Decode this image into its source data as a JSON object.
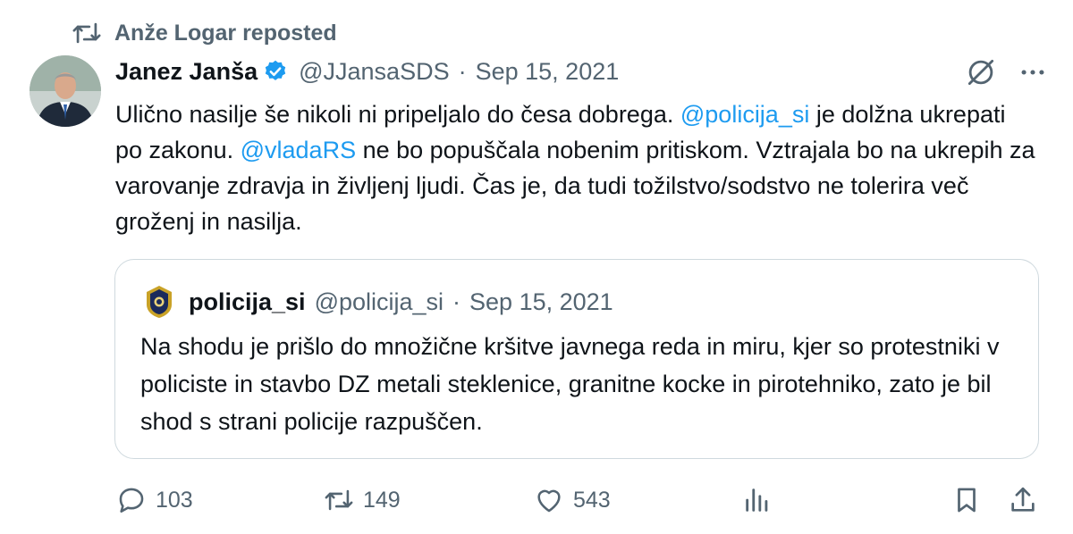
{
  "repost": {
    "label": "Anže Logar reposted"
  },
  "author": {
    "name": "Janez Janša",
    "handle": "@JJansaSDS",
    "separator": "·",
    "date": "Sep 15, 2021"
  },
  "tweet": {
    "part1": "Ulično nasilje še nikoli ni pripeljalo do česa dobrega. ",
    "mention1": "@policija_si",
    "part2": " je dolžna ukrepati po zakonu. ",
    "mention2": "@vladaRS",
    "part3": " ne bo popuščala nobenim pritiskom. Vztrajala bo na ukrepih za varovanje zdravja in življenj ljudi. Čas je, da tudi tožilstvo/sodstvo ne tolerira več groženj in nasilja."
  },
  "quoted": {
    "name": "policija_si",
    "handle": "@policija_si",
    "separator": "·",
    "date": "Sep 15, 2021",
    "text": "Na shodu je prišlo do množične kršitve javnega reda in miru, kjer so protestniki v policiste in stavbo DZ metali steklenice, granitne kocke in pirotehniko, zato je bil shod s strani policije razpuščen."
  },
  "actions": {
    "replies": "103",
    "reposts": "149",
    "likes": "543"
  },
  "icons": {
    "repost": "repost-icon",
    "verified": "verified-badge-icon",
    "grok": "grok-icon",
    "more": "more-icon",
    "reply": "reply-icon",
    "like": "heart-icon",
    "views": "views-icon",
    "bookmark": "bookmark-icon",
    "share": "share-icon"
  },
  "colors": {
    "accent": "#1d9bf0",
    "secondary_text": "#536471",
    "text": "#0f1419",
    "border": "#cfd9de"
  }
}
